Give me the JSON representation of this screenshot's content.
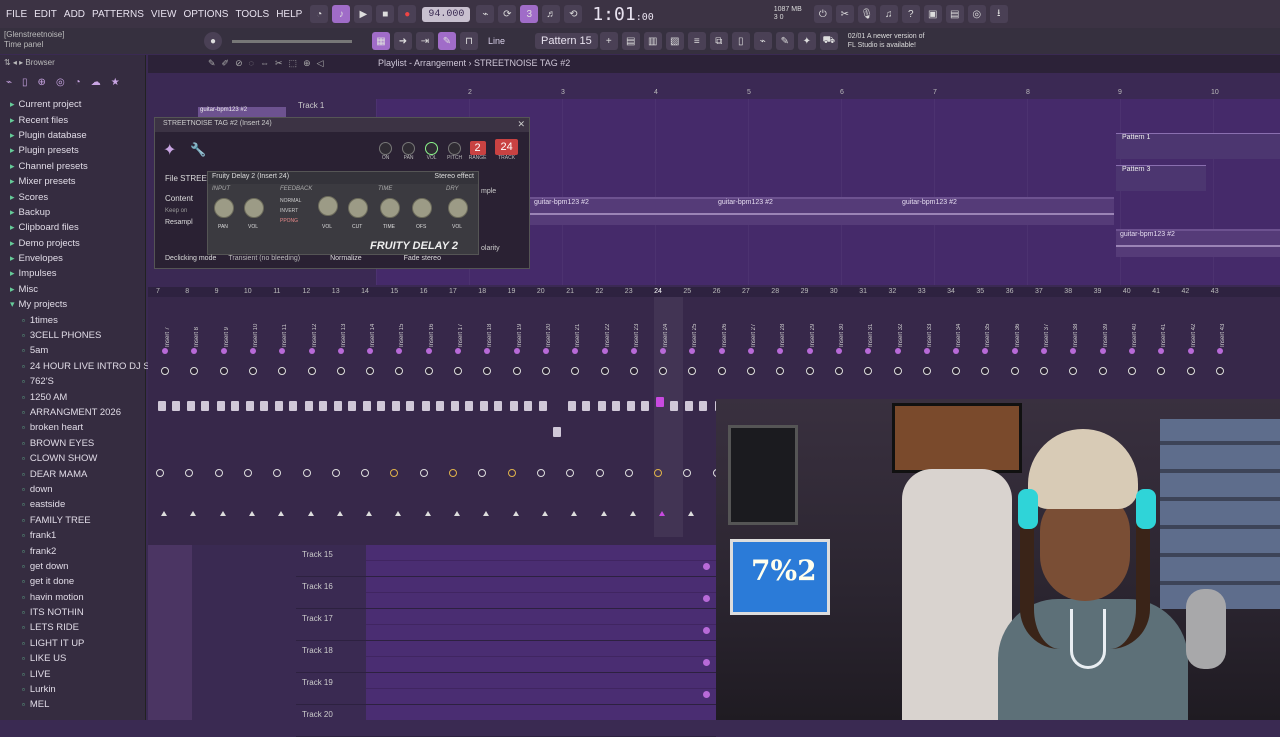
{
  "menu": [
    "FILE",
    "EDIT",
    "ADD",
    "PATTERNS",
    "VIEW",
    "OPTIONS",
    "TOOLS",
    "HELP"
  ],
  "transport": {
    "tempo": "94.000",
    "time": "1:01",
    "time_sub": ":00",
    "memory": "1087 MB",
    "cpu": "3",
    "poly": "0"
  },
  "hint": {
    "line1": "[Glenstreetnoise]",
    "line2": "Time panel"
  },
  "toolbar2": {
    "snap": "Line",
    "pattern": "Pattern 15",
    "news_date": "02/01",
    "news_line1": "A newer version of",
    "news_line2": "FL Studio is available!"
  },
  "browser": {
    "title": "Browser",
    "roots": [
      "Current project",
      "Recent files",
      "Plugin database",
      "Plugin presets",
      "Channel presets",
      "Mixer presets",
      "Scores",
      "Backup",
      "Clipboard files",
      "Demo projects",
      "Envelopes",
      "Impulses",
      "Misc",
      "My projects"
    ],
    "projects": [
      "1times",
      "3CELL PHONES",
      "5am",
      "24 HOUR LIVE INTRO DJ SET",
      "762'S",
      "1250 AM",
      "ARRANGMENT 2026",
      "broken heart",
      "BROWN EYES",
      "CLOWN SHOW",
      "DEAR MAMA",
      "down",
      "eastside",
      "FAMILY TREE",
      "frank1",
      "frank2",
      "get down",
      "get it done",
      "havin motion",
      "ITS NOTHIN",
      "LETS RIDE",
      "LIGHT IT UP",
      "LIKE US",
      "LIVE",
      "Lurkin",
      "MEL"
    ]
  },
  "playlist": {
    "title": "Playlist - Arrangement › STREETNOISE TAG #2",
    "ruler": [
      "2",
      "3",
      "4",
      "5",
      "6",
      "7",
      "8",
      "9",
      "10"
    ],
    "track1": "Track 1",
    "clip_small": "guitar-bpm123 #2",
    "clips": [
      "guitar-bpm123 #2",
      "guitar-bpm123 #2",
      "guitar-bpm123 #2",
      "guitar-bpm123 #2"
    ],
    "patterns": [
      "Pattern 1",
      "Pattern 3"
    ]
  },
  "plugin": {
    "title": "STREETNOISE TAG #2 (Insert 24)",
    "knobs": [
      "ON",
      "PAN",
      "VOL",
      "PITCH",
      "RANGE",
      "TRACK"
    ],
    "range": "2",
    "track": "24",
    "left": [
      "File",
      "STREET",
      "Content",
      "Keep on",
      "Resampl",
      "Declicking mode"
    ],
    "declick": "Transient (no bleeding)",
    "normalize": "Normalize",
    "fade": "Fade stereo",
    "polarity": "olarity",
    "sample": "mple"
  },
  "delay": {
    "title": "Fruity Delay 2 (Insert 24)",
    "preset": "Stereo effect",
    "sections": [
      "INPUT",
      "FEEDBACK",
      "TIME",
      "DRY"
    ],
    "modes": [
      "NORMAL",
      "INVERT",
      "PPONG"
    ],
    "labels": [
      "PAN",
      "VOL",
      "VOL",
      "CUT",
      "TIME",
      "OFS",
      "VOL"
    ],
    "brand": "FRUITY DELAY 2"
  },
  "mixer": {
    "ruler": [
      "7",
      "8",
      "9",
      "10",
      "11",
      "12",
      "13",
      "14",
      "15",
      "16",
      "17",
      "18",
      "19",
      "20",
      "21",
      "22",
      "23",
      "24",
      "25",
      "26",
      "27",
      "28",
      "29",
      "30",
      "31",
      "32",
      "33",
      "34",
      "35",
      "36",
      "37",
      "38",
      "39",
      "40",
      "41",
      "42",
      "43"
    ],
    "inserts": [
      "Insert 7",
      "Insert 8",
      "Insert 9",
      "Insert 10",
      "Insert 11",
      "Insert 12",
      "Insert 13",
      "Insert 14",
      "Insert 15",
      "Insert 16",
      "Insert 17",
      "Insert 18",
      "Insert 19",
      "Insert 20",
      "Insert 21",
      "Insert 22",
      "Insert 23",
      "Insert 24",
      "Insert 25",
      "Insert 26",
      "Insert 27",
      "Insert 28",
      "Insert 29",
      "Insert 30",
      "Insert 31",
      "Insert 32",
      "Insert 33",
      "Insert 34",
      "Insert 35",
      "Insert 36",
      "Insert 37",
      "Insert 38",
      "Insert 39",
      "Insert 40",
      "Insert 41",
      "Insert 42",
      "Insert 43"
    ]
  },
  "tracks2": [
    "Track 15",
    "Track 16",
    "Track 17",
    "Track 18",
    "Track 19",
    "Track 20"
  ],
  "webcam": {
    "frame_text": "7%2"
  }
}
